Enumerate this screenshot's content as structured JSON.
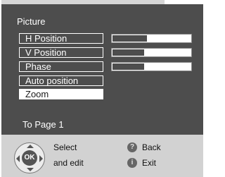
{
  "menu": {
    "title": "Picture",
    "items": [
      {
        "label": "H Position",
        "level": 0.43
      },
      {
        "label": "V Position",
        "level": 0.4
      },
      {
        "label": "Phase",
        "level": 0.4
      },
      {
        "label": "Auto position"
      },
      {
        "label": "Zoom",
        "selected": true
      }
    ],
    "page_link": "To Page 1"
  },
  "help": {
    "ok_label": "OK",
    "select": "Select",
    "edit": "and edit",
    "back": "Back",
    "exit": "Exit",
    "back_icon": "?",
    "exit_icon": "i"
  },
  "colors": {
    "panel": "#4d4d4d",
    "help_bar": "#d2d2d2",
    "highlight": "#ffffff"
  },
  "icons": {
    "dpad": "dpad-ok-icon",
    "back": "back-icon",
    "exit": "exit-icon"
  }
}
